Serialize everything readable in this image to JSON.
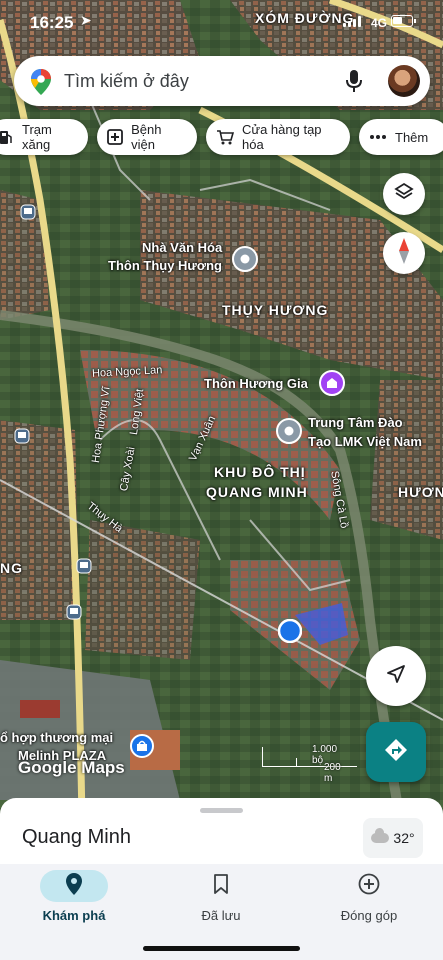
{
  "status_bar": {
    "time": "16:25",
    "network": "4G"
  },
  "search": {
    "placeholder": "Tìm kiếm ở đây"
  },
  "chips": [
    {
      "label": "Trạm xăng",
      "icon": "gas-station-icon"
    },
    {
      "label": "Bệnh viện",
      "icon": "hospital-icon"
    },
    {
      "label": "Cửa hàng tạp hóa",
      "icon": "cart-icon"
    },
    {
      "label": "Thêm",
      "icon": "more-dots-icon"
    }
  ],
  "map": {
    "labels": {
      "xom_duong": "XÓM ĐƯỜNG",
      "nha_van_hoa_1": "Nhà Văn Hóa",
      "nha_van_hoa_2": "Thôn Thụy Hương",
      "thuy_huong": "THỤY HƯƠNG",
      "hoa_ngoc_lan": "Hoa Ngọc Lan",
      "thon_huong_gia": "Thôn Hương Gia",
      "long_viet": "Long Việt",
      "van_xuan": "Vạn Xuân",
      "trung_tam_1": "Trung Tâm Đào",
      "trung_tam_2": "Tạo LMK Việt Nam",
      "hoa_phuong_vi": "Hoa Phượng Vĩ",
      "cay_xoai": "Cây Xoài",
      "khu_do_thi_1": "KHU ĐÔ THỊ",
      "khu_do_thi_2": "QUANG MINH",
      "song_ca_lo": "Sông Cà Lồ",
      "huong": "HƯƠN",
      "thuy_ha": "Thụy Hà",
      "ng": "NG",
      "to_hop_1": "ổ hợp thương mại",
      "to_hop_2": "Melinh PLAZA"
    },
    "scale": {
      "ft": "1.000 bộ",
      "m": "200 m"
    },
    "attribution": "Google Maps"
  },
  "sheet": {
    "place": "Quang Minh",
    "weather": {
      "temp": "32°",
      "icon": "cloud-icon"
    }
  },
  "tabs": [
    {
      "label": "Khám phá",
      "icon": "explore-pin-icon",
      "active": true
    },
    {
      "label": "Đã lưu",
      "icon": "bookmark-icon",
      "active": false
    },
    {
      "label": "Đóng góp",
      "icon": "add-circle-icon",
      "active": false
    }
  ],
  "colors": {
    "accent": "#0b8184",
    "location_dot": "#1a73e8",
    "poi_purple": "#a142f4",
    "poi_gray": "#8a99a6"
  }
}
